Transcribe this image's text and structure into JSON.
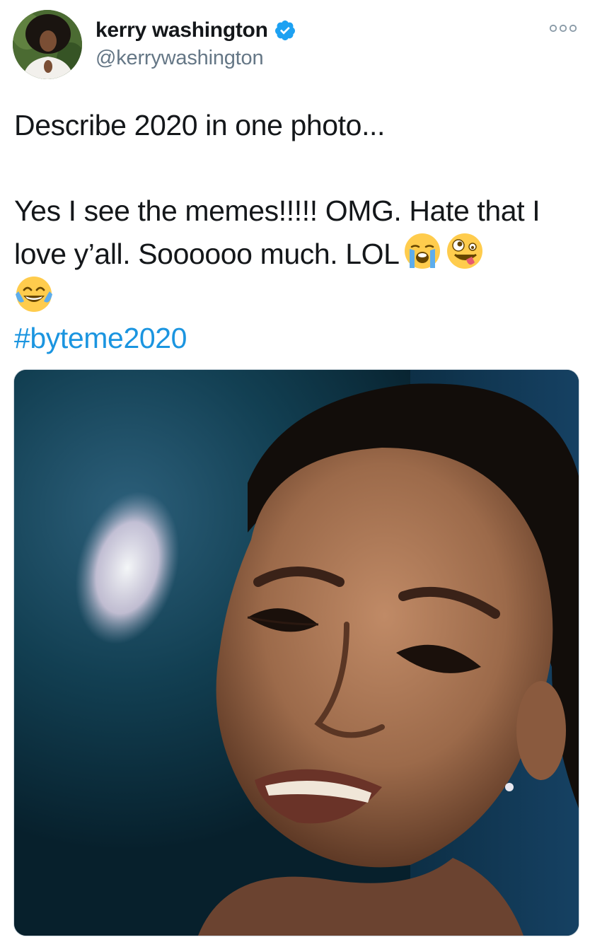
{
  "tweet": {
    "author": {
      "display_name": "kerry washington",
      "handle": "@kerrywashington",
      "verified": true,
      "avatar_icon": "profile-photo"
    },
    "more_icon": "more-options-icon",
    "text": {
      "line1": "Describe 2020 in one photo...",
      "line2": "Yes I see the memes!!!!! OMG. Hate that I love y’all. Soooooo much. LOL",
      "emojis": [
        "loudly-crying-face",
        "zany-face",
        "face-with-tears-of-joy"
      ],
      "hashtag": "#byteme2020"
    },
    "media": {
      "type": "photo",
      "alt": ""
    },
    "colors": {
      "text": "#14171a",
      "secondary": "#657786",
      "link": "#1b95e0",
      "verified_badge": "#1da1f2"
    }
  }
}
